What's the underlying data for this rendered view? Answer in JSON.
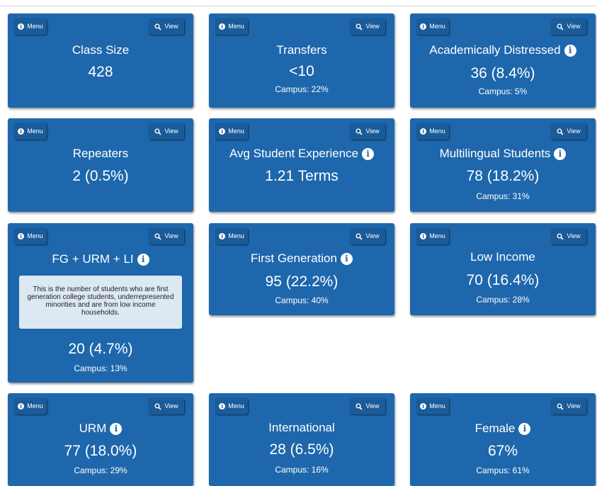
{
  "buttons": {
    "menu_label": "Menu",
    "view_label": "View"
  },
  "icons": {
    "menu": "info-icon",
    "view": "search-icon",
    "title_info": "info-icon"
  },
  "colors": {
    "card": "#1e67ac",
    "button": "#1a5b99",
    "tooltip_bg": "#dce8f2"
  },
  "cards": [
    {
      "title": "Class Size",
      "value": "428"
    },
    {
      "title": "Transfers",
      "value": "<10",
      "campus": "Campus: 22%"
    },
    {
      "title": "Academically Distressed",
      "value": "36 (8.4%)",
      "campus": "Campus: 5%"
    },
    {
      "title": "Repeaters",
      "value": "2 (0.5%)"
    },
    {
      "title": "Avg Student Experience",
      "value": "1.21 Terms"
    },
    {
      "title": "Multilingual Students",
      "value": "78 (18.2%)",
      "campus": "Campus: 31%"
    },
    {
      "title": "FG + URM + LI",
      "value": "20 (4.7%)",
      "campus": "Campus: 13%",
      "tooltip": "This is the number of students who are first generation college students, underrepresented minorities and are from low income households."
    },
    {
      "title": "First Generation",
      "value": "95 (22.2%)",
      "campus": "Campus: 40%"
    },
    {
      "title": "Low Income",
      "value": "70 (16.4%)",
      "campus": "Campus: 28%"
    },
    {
      "title": "URM",
      "value": "77 (18.0%)",
      "campus": "Campus: 29%"
    },
    {
      "title": "International",
      "value": "28 (6.5%)",
      "campus": "Campus: 16%"
    },
    {
      "title": "Female",
      "value": "67%",
      "campus": "Campus: 61%"
    }
  ]
}
